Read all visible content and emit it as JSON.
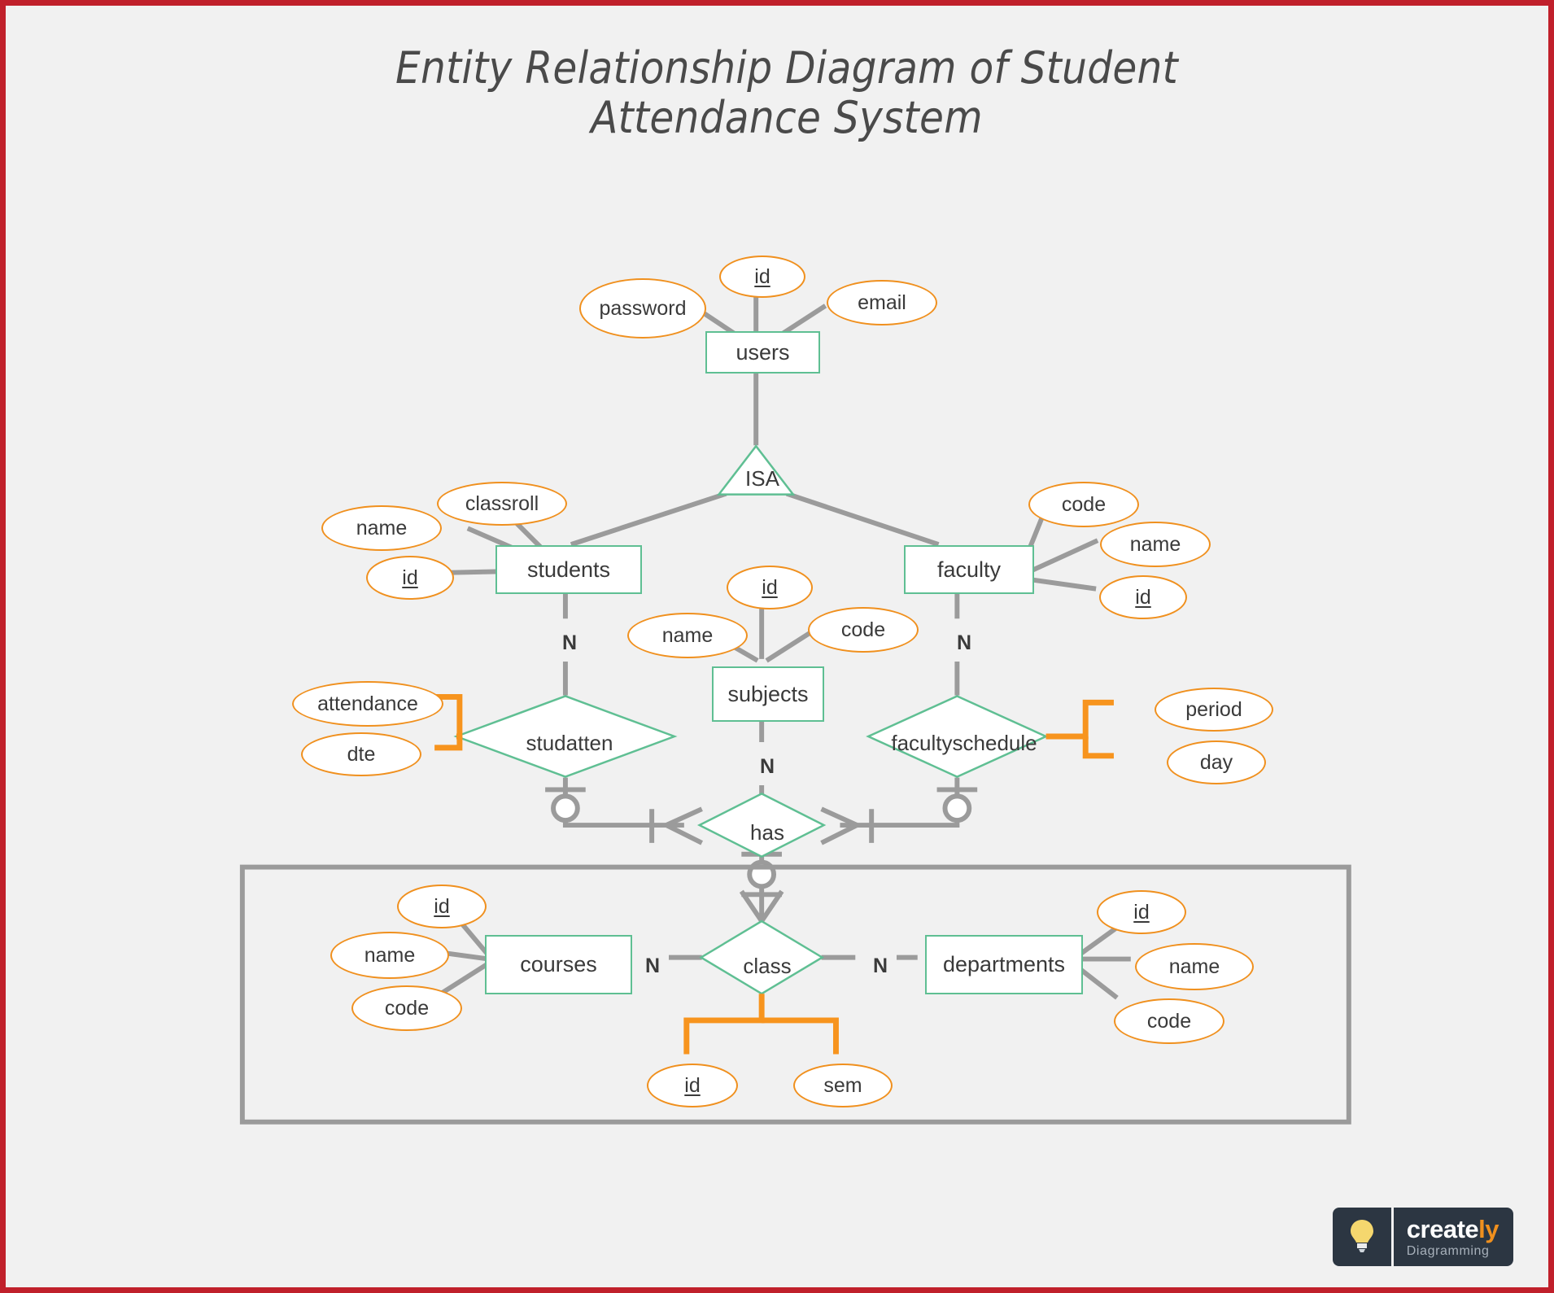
{
  "title": {
    "line1": "Entity Relationship Diagram of Student",
    "line2": "Attendance System"
  },
  "colors": {
    "canvas": "#f1f1f1",
    "frame_border": "#c0202b",
    "entity_border": "#5fbf93",
    "attribute_border": "#f0901e",
    "connector": "#9b9b9b",
    "attribute_connector": "#f0901e",
    "text": "#3a3a3a",
    "group_border": "#9b9b9b"
  },
  "entities": {
    "users": {
      "label": "users"
    },
    "students": {
      "label": "students"
    },
    "faculty": {
      "label": "faculty"
    },
    "subjects": {
      "label": "subjects"
    },
    "courses": {
      "label": "courses"
    },
    "departments": {
      "label": "departments"
    }
  },
  "relationships": {
    "isa": {
      "label": "ISA"
    },
    "studatten": {
      "label": "studatten"
    },
    "facultyschedule": {
      "label": "facultyschedule"
    },
    "has": {
      "label": "has"
    },
    "class": {
      "label": "class"
    }
  },
  "attributes": {
    "users_password": {
      "label": "password",
      "key": false
    },
    "users_id": {
      "label": "id",
      "key": true
    },
    "users_email": {
      "label": "email",
      "key": false
    },
    "students_name": {
      "label": "name",
      "key": false
    },
    "students_classroll": {
      "label": "classroll",
      "key": false
    },
    "students_id": {
      "label": "id",
      "key": true
    },
    "faculty_code": {
      "label": "code",
      "key": false
    },
    "faculty_name": {
      "label": "name",
      "key": false
    },
    "faculty_id": {
      "label": "id",
      "key": true
    },
    "subjects_id": {
      "label": "id",
      "key": true
    },
    "subjects_name": {
      "label": "name",
      "key": false
    },
    "subjects_code": {
      "label": "code",
      "key": false
    },
    "studatten_attendance": {
      "label": "attendance",
      "key": false
    },
    "studatten_dte": {
      "label": "dte",
      "key": false
    },
    "facultyschedule_period": {
      "label": "period",
      "key": false
    },
    "facultyschedule_day": {
      "label": "day",
      "key": false
    },
    "courses_id": {
      "label": "id",
      "key": true
    },
    "courses_name": {
      "label": "name",
      "key": false
    },
    "courses_code": {
      "label": "code",
      "key": false
    },
    "class_id": {
      "label": "id",
      "key": true
    },
    "class_sem": {
      "label": "sem",
      "key": false
    },
    "departments_id": {
      "label": "id",
      "key": true
    },
    "departments_name": {
      "label": "name",
      "key": false
    },
    "departments_code": {
      "label": "code",
      "key": false
    }
  },
  "cardinalities": {
    "students_studatten": "N",
    "faculty_facultyschedule": "N",
    "subjects_has": "N",
    "courses_class": "N",
    "class_departments": "N"
  },
  "watermark": {
    "brand_primary": "create",
    "brand_accent": "ly",
    "tagline": "Diagramming",
    "icon": "lightbulb-icon"
  }
}
